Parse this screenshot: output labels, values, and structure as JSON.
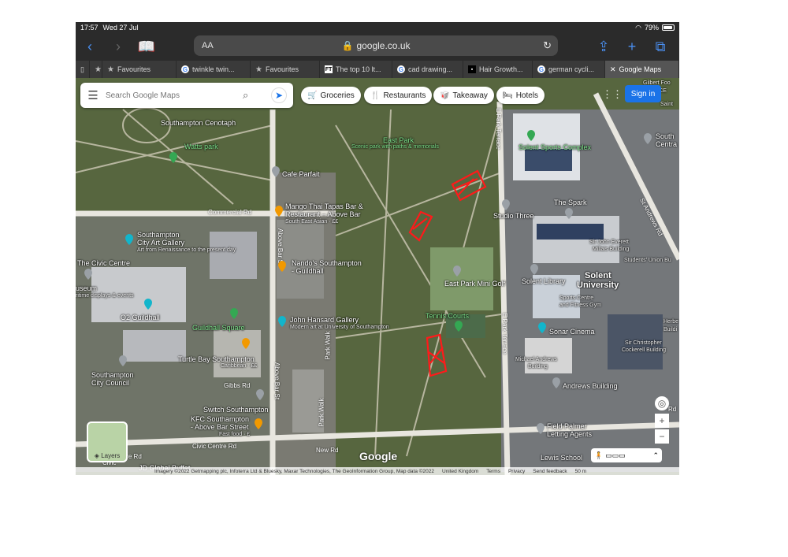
{
  "status": {
    "time": "17:57",
    "date": "Wed 27 Jul",
    "battery": "79%"
  },
  "browser": {
    "text_size": "AA",
    "url": "google.co.uk",
    "tabs": [
      {
        "label": "",
        "icon": "tab-overview-icon"
      },
      {
        "label": "Favourites",
        "icon": "star-icon"
      },
      {
        "label": "twinkle twin...",
        "icon": "google-icon"
      },
      {
        "label": "Favourites",
        "icon": "star-icon"
      },
      {
        "label": "The top 10 lt...",
        "icon": "ft-icon"
      },
      {
        "label": "cad drawing...",
        "icon": "google-icon"
      },
      {
        "label": "Hair Growth...",
        "icon": "site-icon"
      },
      {
        "label": "german cycli...",
        "icon": "google-icon"
      },
      {
        "label": "Google Maps",
        "icon": "close-icon"
      }
    ]
  },
  "maps": {
    "search_placeholder": "Search Google Maps",
    "chips": [
      "Groceries",
      "Restaurants",
      "Takeaway",
      "Hotels"
    ],
    "sign_in": "Sign in",
    "layers": "Layers",
    "logo": "Google",
    "footer": [
      "Imagery ©2022 Getmapping plc, Infoterra Ltd & Bluesky, Maxar Technologies, The GeoInformation Group, Map data ©2022",
      "United Kingdom",
      "Terms",
      "Privacy",
      "Send feedback",
      "50 m"
    ],
    "places": [
      {
        "name": "Southampton Cenotaph"
      },
      {
        "name": "Watts park"
      },
      {
        "name": "East Park"
      },
      {
        "name": "Scenic park with paths & memorials"
      },
      {
        "name": "Cafe Parfait"
      },
      {
        "name": "Mango Thai Tapas Bar &"
      },
      {
        "name": "Restaurant – Above Bar"
      },
      {
        "name": "South East Asian · ££"
      },
      {
        "name": "Southampton"
      },
      {
        "name": "City Art Gallery"
      },
      {
        "name": "Art from Renaissance to the present day"
      },
      {
        "name": "The Civic Centre"
      },
      {
        "name": "Nando's Southampton"
      },
      {
        "name": "- Guildhall"
      },
      {
        "name": "useum"
      },
      {
        "name": "ritime displays & events"
      },
      {
        "name": "O2 Guildhall"
      },
      {
        "name": "Guildhall Square"
      },
      {
        "name": "John Hansard Gallery"
      },
      {
        "name": "Modern art at University of Southampton"
      },
      {
        "name": "Turtle Bay Southampton"
      },
      {
        "name": "Caribbean · ££"
      },
      {
        "name": "Southampton"
      },
      {
        "name": "City Council"
      },
      {
        "name": "Gibbs Rd"
      },
      {
        "name": "Switch Southampton"
      },
      {
        "name": "KFC Southampton"
      },
      {
        "name": "- Above Bar Street"
      },
      {
        "name": "Fast food · £"
      },
      {
        "name": "Civic Centre Rd"
      },
      {
        "name": "New Rd"
      },
      {
        "name": "JD Global Buffet"
      },
      {
        "name": "Solent Sports Complex"
      },
      {
        "name": "The Spark"
      },
      {
        "name": "Studio Three"
      },
      {
        "name": "Sir John Everett"
      },
      {
        "name": "Millais Building"
      },
      {
        "name": "Students' Union Bu"
      },
      {
        "name": "East Park Mini Golf"
      },
      {
        "name": "Solent Library"
      },
      {
        "name": "Solent"
      },
      {
        "name": "University"
      },
      {
        "name": "Sports Centre"
      },
      {
        "name": "and Fitness Gym"
      },
      {
        "name": "Tennis Courts"
      },
      {
        "name": "Sonar Cinema"
      },
      {
        "name": "Herbe"
      },
      {
        "name": "Buildi"
      },
      {
        "name": "Sir Christopher"
      },
      {
        "name": "Cockerell Building"
      },
      {
        "name": "Michael Andrews"
      },
      {
        "name": "Building"
      },
      {
        "name": "Andrews Building"
      },
      {
        "name": "Field Palmer"
      },
      {
        "name": "Letting Agents"
      },
      {
        "name": "Lewis School"
      },
      {
        "name": "Gilbert Foo"
      },
      {
        "name": "LI-CE"
      },
      {
        "name": "Saint"
      },
      {
        "name": "South"
      },
      {
        "name": "Centra"
      }
    ],
    "roads": [
      {
        "name": "Commercial Rd"
      },
      {
        "name": "Above Bar St"
      },
      {
        "name": "Above Bar St"
      },
      {
        "name": "Park Walk"
      },
      {
        "name": "Park Walk"
      },
      {
        "name": "E Park Terrace"
      },
      {
        "name": "E Park Terrace"
      },
      {
        "name": "St Andrews Rd"
      },
      {
        "name": "tre Rd"
      },
      {
        "name": "Civic"
      },
      {
        "name": "Rd"
      }
    ]
  },
  "colors": {
    "accent": "#1a73e8",
    "annotation": "#ff1a1a",
    "chrome": "#2b2b2b"
  }
}
